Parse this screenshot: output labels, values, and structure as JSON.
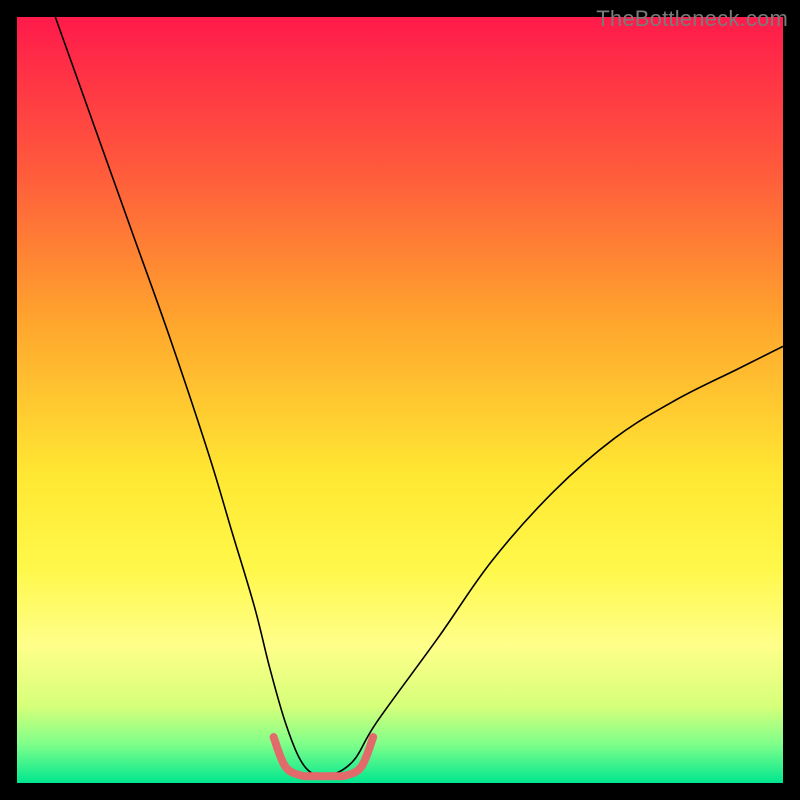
{
  "watermark": "TheBottleneck.com",
  "chart_data": {
    "type": "line",
    "title": "",
    "xlabel": "",
    "ylabel": "",
    "xlim": [
      0,
      100
    ],
    "ylim": [
      0,
      100
    ],
    "grid": false,
    "background_gradient": {
      "direction": "vertical",
      "stops": [
        {
          "offset": 0.0,
          "color": "#ff1a4b"
        },
        {
          "offset": 0.2,
          "color": "#ff5a3c"
        },
        {
          "offset": 0.4,
          "color": "#ffa62d"
        },
        {
          "offset": 0.6,
          "color": "#ffe833"
        },
        {
          "offset": 0.72,
          "color": "#fff84a"
        },
        {
          "offset": 0.82,
          "color": "#ffff8a"
        },
        {
          "offset": 0.9,
          "color": "#d6ff7a"
        },
        {
          "offset": 0.95,
          "color": "#7dff8a"
        },
        {
          "offset": 1.0,
          "color": "#00e68f"
        }
      ]
    },
    "series": [
      {
        "name": "bottleneck_curve",
        "stroke": "#000000",
        "stroke_width": 1.6,
        "x": [
          5,
          10,
          15,
          20,
          25,
          28,
          31,
          33,
          35,
          37,
          39,
          41,
          44,
          47,
          55,
          62,
          70,
          78,
          86,
          94,
          100
        ],
        "y": [
          100,
          86,
          72,
          58,
          43,
          33,
          23,
          15,
          8,
          3,
          1,
          1,
          3,
          8,
          19,
          29,
          38,
          45,
          50,
          54,
          57
        ]
      },
      {
        "name": "optimal_zone_marker",
        "stroke": "#e26a6a",
        "stroke_width": 8,
        "linecap": "round",
        "x": [
          33.5,
          35,
          37,
          39,
          41,
          43,
          45,
          46.5
        ],
        "y": [
          6,
          2.2,
          1.0,
          0.9,
          0.9,
          1.0,
          2.2,
          6
        ]
      }
    ]
  }
}
